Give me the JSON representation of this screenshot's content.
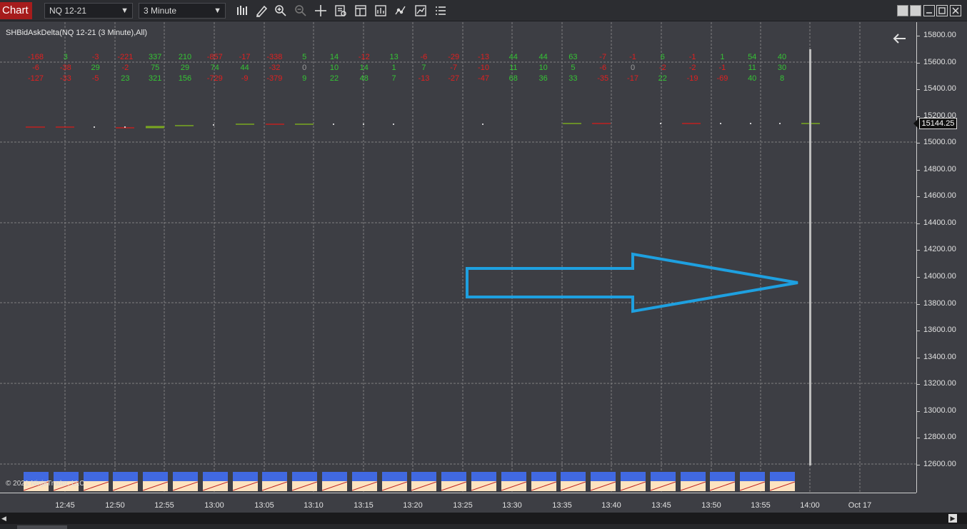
{
  "toolbar": {
    "tab_label": "Chart",
    "instrument": "NQ 12-21",
    "interval": "3 Minute",
    "tools": [
      "bar-style-icon",
      "draw-pencil-icon",
      "zoom-in-icon",
      "zoom-out-icon",
      "crosshair-icon",
      "data-box-icon",
      "templates-icon",
      "strategies-icon",
      "indicators-icon",
      "properties-icon",
      "list-icon"
    ]
  },
  "indicator": {
    "label": "SHBidAskDelta(NQ 12-21 (3 Minute),All)"
  },
  "copyright": "© 2021 NinjaTrader, LLC",
  "price_axis": {
    "ticks": [
      "15800.00",
      "15600.00",
      "15400.00",
      "15200.00",
      "15000.00",
      "14800.00",
      "14600.00",
      "14400.00",
      "14200.00",
      "14000.00",
      "13800.00",
      "13600.00",
      "13400.00",
      "13200.00",
      "13000.00",
      "12800.00",
      "12600.00"
    ],
    "current_price": "15144.25"
  },
  "time_axis": {
    "ticks": [
      "12:45",
      "12:50",
      "12:55",
      "13:00",
      "13:05",
      "13:10",
      "13:15",
      "13:20",
      "13:25",
      "13:30",
      "13:35",
      "13:40",
      "13:45",
      "13:50",
      "13:55",
      "14:00",
      "Oct 17"
    ]
  },
  "delta_columns": [
    {
      "row1": "-168",
      "row2": "-6",
      "row3": "-127",
      "c1": "red",
      "c2": "red",
      "c3": "red"
    },
    {
      "row1": "3",
      "row2": "-38",
      "row3": "-33",
      "c1": "green",
      "c2": "red",
      "c3": "red"
    },
    {
      "row1": "-3",
      "row2": "29",
      "row3": "-5",
      "c1": "red",
      "c2": "green",
      "c3": "red"
    },
    {
      "row1": "-221",
      "row2": "-2",
      "row3": "23",
      "c1": "red",
      "c2": "red",
      "c3": "green"
    },
    {
      "row1": "337",
      "row2": "75",
      "row3": "321",
      "c1": "green",
      "c2": "green",
      "c3": "green"
    },
    {
      "row1": "210",
      "row2": "29",
      "row3": "156",
      "c1": "green",
      "c2": "green",
      "c3": "green"
    },
    {
      "row1": "-857",
      "row2": "74",
      "row3": "-729",
      "c1": "red",
      "c2": "green",
      "c3": "red"
    },
    {
      "row1": "-17",
      "row2": "44",
      "row3": "-9",
      "c1": "red",
      "c2": "green",
      "c3": "red"
    },
    {
      "row1": "-338",
      "row2": "-32",
      "row3": "-379",
      "c1": "red",
      "c2": "red",
      "c3": "red"
    },
    {
      "row1": "5",
      "row2": "0",
      "row3": "9",
      "c1": "green",
      "c2": "gray",
      "c3": "green"
    },
    {
      "row1": "14",
      "row2": "10",
      "row3": "22",
      "c1": "green",
      "c2": "green",
      "c3": "green"
    },
    {
      "row1": "-12",
      "row2": "14",
      "row3": "48",
      "c1": "red",
      "c2": "green",
      "c3": "green"
    },
    {
      "row1": "13",
      "row2": "1",
      "row3": "7",
      "c1": "green",
      "c2": "green",
      "c3": "green"
    },
    {
      "row1": "-6",
      "row2": "7",
      "row3": "-13",
      "c1": "red",
      "c2": "green",
      "c3": "red"
    },
    {
      "row1": "-29",
      "row2": "-7",
      "row3": "-27",
      "c1": "red",
      "c2": "red",
      "c3": "red"
    },
    {
      "row1": "-13",
      "row2": "-10",
      "row3": "-47",
      "c1": "red",
      "c2": "red",
      "c3": "red"
    },
    {
      "row1": "44",
      "row2": "11",
      "row3": "68",
      "c1": "green",
      "c2": "green",
      "c3": "green"
    },
    {
      "row1": "44",
      "row2": "10",
      "row3": "36",
      "c1": "green",
      "c2": "green",
      "c3": "green"
    },
    {
      "row1": "63",
      "row2": "5",
      "row3": "33",
      "c1": "green",
      "c2": "green",
      "c3": "green"
    },
    {
      "row1": "-7",
      "row2": "-6",
      "row3": "-35",
      "c1": "red",
      "c2": "red",
      "c3": "red"
    },
    {
      "row1": "-1",
      "row2": "0",
      "row3": "-17",
      "c1": "red",
      "c2": "gray",
      "c3": "red"
    },
    {
      "row1": "6",
      "row2": "-2",
      "row3": "22",
      "c1": "green",
      "c2": "red",
      "c3": "green"
    },
    {
      "row1": "-1",
      "row2": "-2",
      "row3": "-19",
      "c1": "red",
      "c2": "red",
      "c3": "red"
    },
    {
      "row1": "1",
      "row2": "-1",
      "row3": "-69",
      "c1": "green",
      "c2": "red",
      "c3": "red"
    },
    {
      "row1": "54",
      "row2": "11",
      "row3": "40",
      "c1": "green",
      "c2": "green",
      "c3": "green"
    },
    {
      "row1": "40",
      "row2": "30",
      "row3": "8",
      "c1": "green",
      "c2": "green",
      "c3": "green"
    }
  ],
  "colors": {
    "bull": "#35c435",
    "bear": "#e02020",
    "annotation_arrow": "#1ea0e0",
    "bid_box_top": "#4169e1",
    "bid_box_bottom": "#fde3c0"
  }
}
